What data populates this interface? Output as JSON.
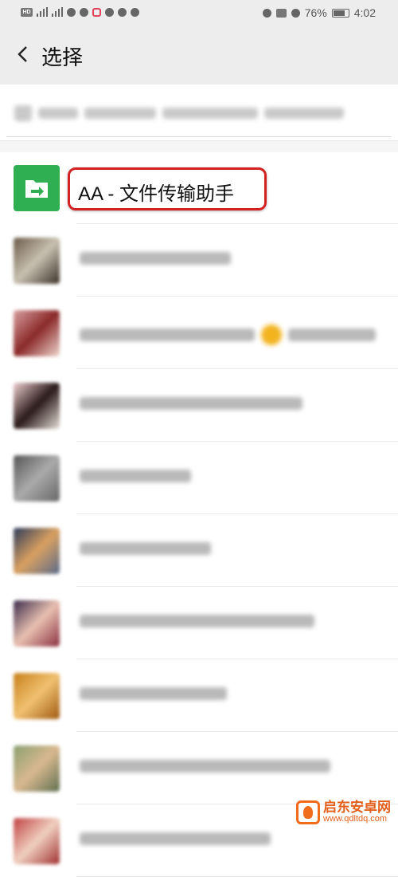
{
  "status_bar": {
    "hd": "HD",
    "net1": "4G",
    "net2": "4G",
    "battery_percent": "76%",
    "time": "4:02"
  },
  "header": {
    "title": "选择"
  },
  "list": {
    "first_item": {
      "name": "AA - 文件传输助手"
    }
  },
  "watermark": {
    "name": "启东安卓网",
    "url": "www.qdltdq.com"
  }
}
